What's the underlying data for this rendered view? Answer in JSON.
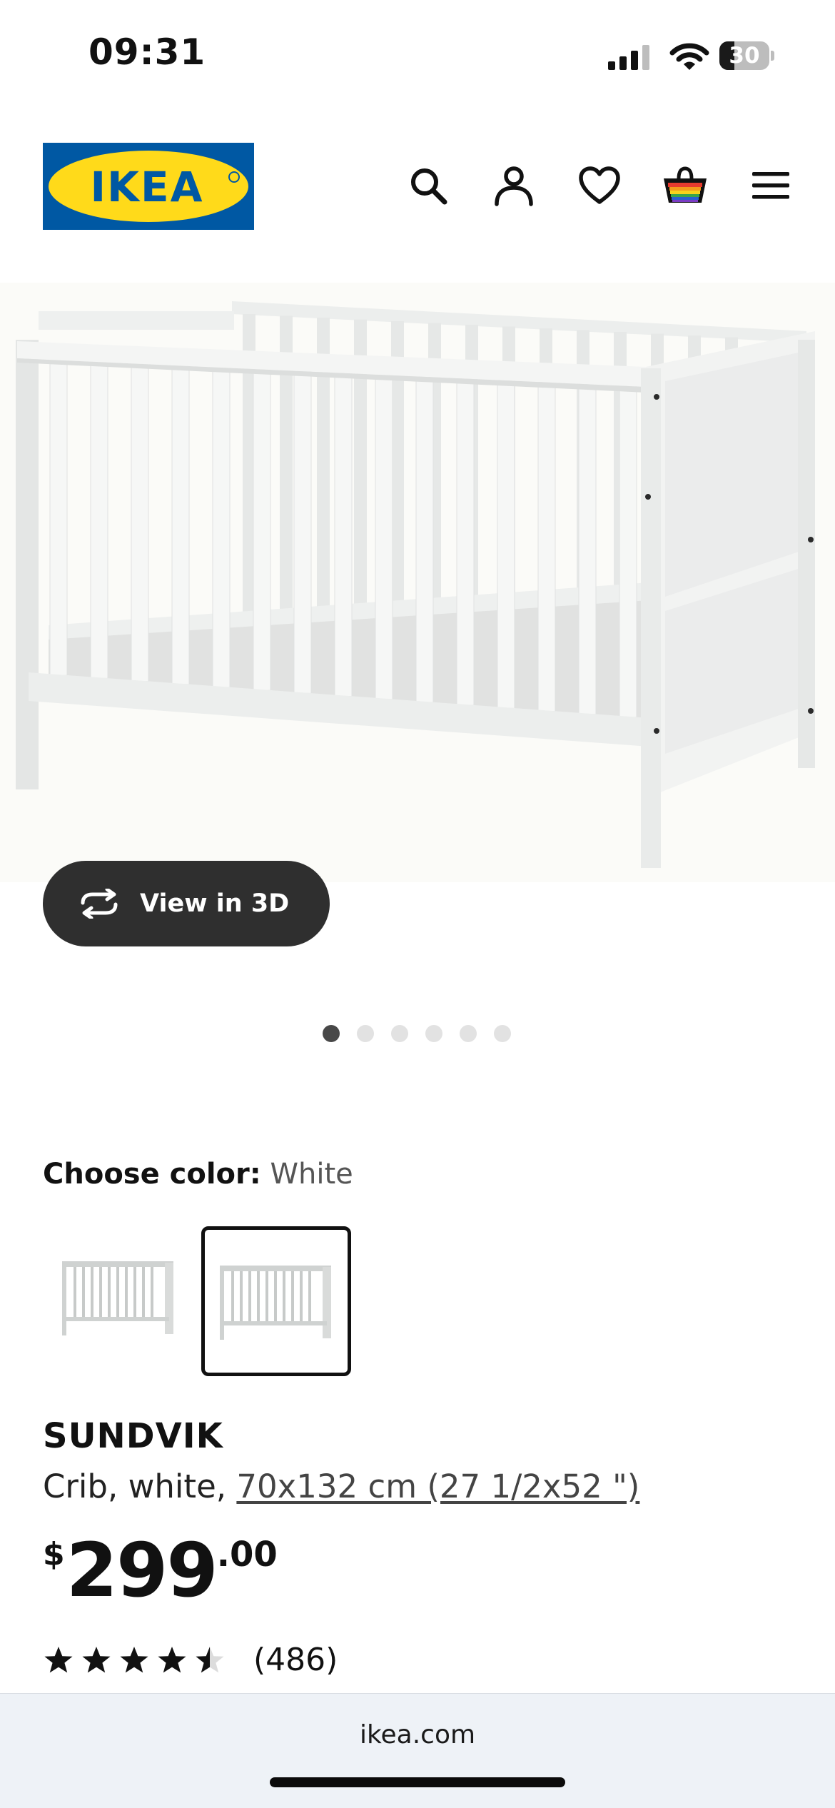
{
  "status_bar": {
    "time": "09:31",
    "battery_level": "30",
    "battery_fraction": 0.3
  },
  "header": {
    "logo_text": "IKEA",
    "logo_colors": {
      "blue": "#0058A3",
      "yellow": "#FFDA1A"
    },
    "icons": [
      "search-icon",
      "account-icon",
      "heart-icon",
      "cart-icon",
      "menu-icon"
    ]
  },
  "gallery": {
    "view_3d_label": "View in 3D",
    "dots": 6,
    "active_dot": 1
  },
  "color": {
    "label": "Choose color:",
    "selected": "White",
    "selected_swatch": 2
  },
  "product": {
    "name": "SUNDVIK",
    "description": "Crib, white, ",
    "size": "70x132 cm (27 1/2x52 \")",
    "price": {
      "currency": "$",
      "integer": "299",
      "decimal": ".00"
    },
    "rating": {
      "stars": 4.5,
      "out_of": 5,
      "count": "(486)"
    }
  },
  "browser": {
    "url": "ikea.com"
  }
}
